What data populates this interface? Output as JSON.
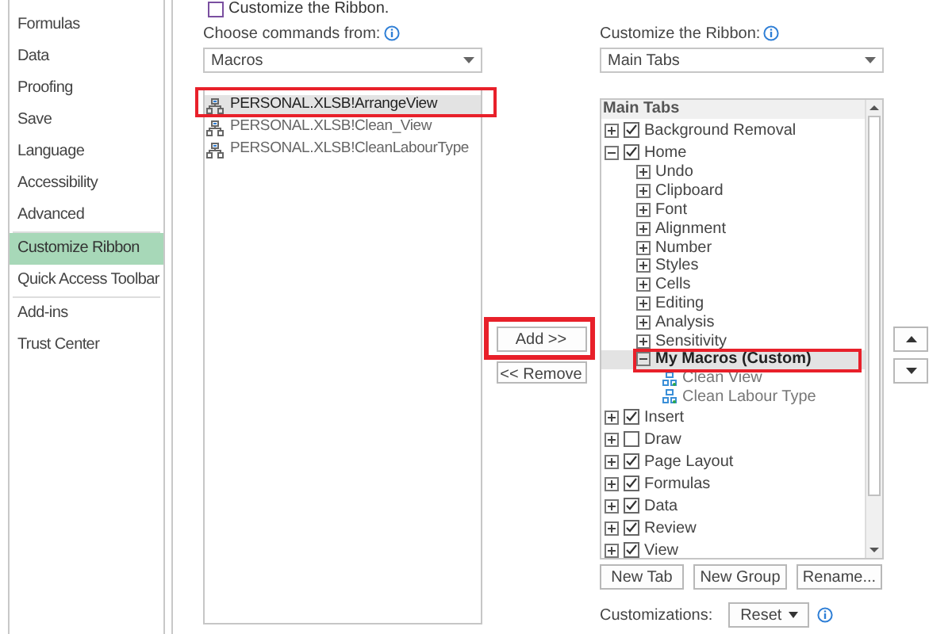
{
  "sidebar": {
    "items": [
      {
        "label": "Formulas",
        "selected": false
      },
      {
        "label": "Data",
        "selected": false
      },
      {
        "label": "Proofing",
        "selected": false
      },
      {
        "label": "Save",
        "selected": false
      },
      {
        "label": "Language",
        "selected": false
      },
      {
        "label": "Accessibility",
        "selected": false
      },
      {
        "label": "Advanced",
        "selected": false
      },
      {
        "label": "Customize Ribbon",
        "selected": true
      },
      {
        "label": "Quick Access Toolbar",
        "selected": false
      },
      {
        "label": "Add-ins",
        "selected": false
      },
      {
        "label": "Trust Center",
        "selected": false
      }
    ]
  },
  "heading": "Customize the Ribbon.",
  "commands_panel": {
    "label": "Choose commands from:",
    "dropdown": "Macros",
    "items": [
      {
        "label": "PERSONAL.XLSB!ArrangeView",
        "selected": true
      },
      {
        "label": "PERSONAL.XLSB!Clean_View",
        "selected": false
      },
      {
        "label": "PERSONAL.XLSB!CleanLabourType",
        "selected": false
      }
    ]
  },
  "add_button": "Add >>",
  "remove_button": "<< Remove",
  "ribbon_panel": {
    "label": "Customize the Ribbon:",
    "dropdown": "Main Tabs",
    "tree_header": "Main Tabs",
    "tree": [
      {
        "kind": "tab",
        "label": "Background Removal",
        "checked": true,
        "expanded": false,
        "selected": false
      },
      {
        "kind": "tab",
        "label": "Home",
        "checked": true,
        "expanded": true,
        "selected": false,
        "children": [
          {
            "kind": "group",
            "label": "Undo",
            "expanded": false,
            "selected": false
          },
          {
            "kind": "group",
            "label": "Clipboard",
            "expanded": false,
            "selected": false
          },
          {
            "kind": "group",
            "label": "Font",
            "expanded": false,
            "selected": false
          },
          {
            "kind": "group",
            "label": "Alignment",
            "expanded": false,
            "selected": false
          },
          {
            "kind": "group",
            "label": "Number",
            "expanded": false,
            "selected": false
          },
          {
            "kind": "group",
            "label": "Styles",
            "expanded": false,
            "selected": false
          },
          {
            "kind": "group",
            "label": "Cells",
            "expanded": false,
            "selected": false
          },
          {
            "kind": "group",
            "label": "Editing",
            "expanded": false,
            "selected": false
          },
          {
            "kind": "group",
            "label": "Analysis",
            "expanded": false,
            "selected": false
          },
          {
            "kind": "group",
            "label": "Sensitivity",
            "expanded": false,
            "selected": false
          },
          {
            "kind": "group",
            "label": "My Macros (Custom)",
            "expanded": true,
            "selected": true,
            "children": [
              {
                "kind": "command",
                "label": "Clean View",
                "selected": false
              },
              {
                "kind": "command",
                "label": "Clean Labour Type",
                "selected": false
              }
            ]
          }
        ]
      },
      {
        "kind": "tab",
        "label": "Insert",
        "checked": true,
        "expanded": false,
        "selected": false
      },
      {
        "kind": "tab",
        "label": "Draw",
        "checked": false,
        "expanded": false,
        "selected": false
      },
      {
        "kind": "tab",
        "label": "Page Layout",
        "checked": true,
        "expanded": false,
        "selected": false
      },
      {
        "kind": "tab",
        "label": "Formulas",
        "checked": true,
        "expanded": false,
        "selected": false
      },
      {
        "kind": "tab",
        "label": "Data",
        "checked": true,
        "expanded": false,
        "selected": false
      },
      {
        "kind": "tab",
        "label": "Review",
        "checked": true,
        "expanded": false,
        "selected": false
      },
      {
        "kind": "tab",
        "label": "View",
        "checked": true,
        "expanded": false,
        "selected": false
      }
    ]
  },
  "tree_buttons": [
    "New Tab",
    "New Group",
    "Rename..."
  ],
  "customizations": {
    "label": "Customizations:",
    "reset_button": "Reset"
  }
}
